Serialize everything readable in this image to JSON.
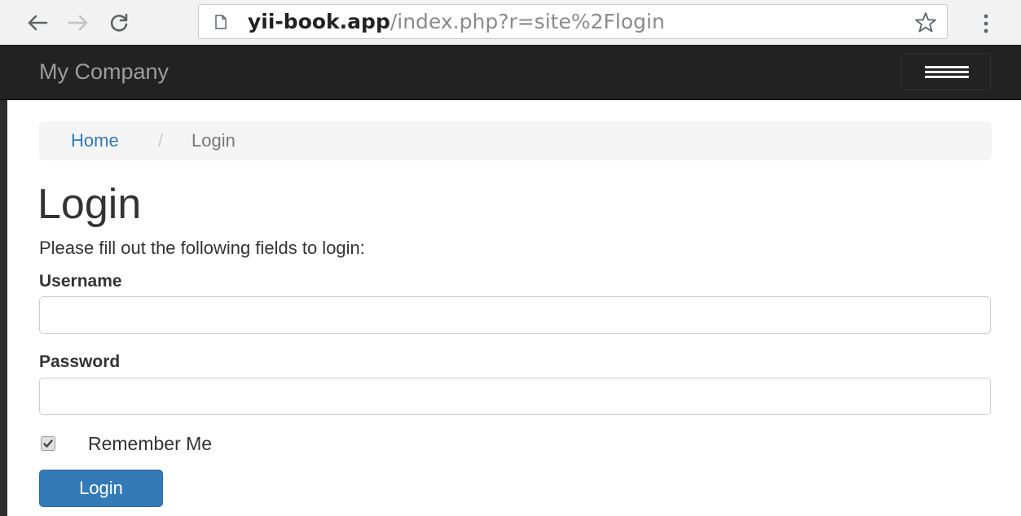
{
  "browser": {
    "url_host": "yii-book.app",
    "url_path": "/index.php?r=site%2Flogin",
    "icons": {
      "back": "arrow-left-icon",
      "forward": "arrow-right-icon",
      "reload": "reload-icon",
      "page": "page-icon",
      "bookmark": "star-icon",
      "menu": "kebab-menu-icon"
    }
  },
  "navbar": {
    "brand": "My Company",
    "toggle_icon": "hamburger-icon"
  },
  "breadcrumb": {
    "home": "Home",
    "separator": "/",
    "active": "Login"
  },
  "page": {
    "title": "Login",
    "description": "Please fill out the following fields to login:"
  },
  "form": {
    "username_label": "Username",
    "username_value": "",
    "password_label": "Password",
    "password_value": "",
    "remember_label": "Remember Me",
    "remember_checked": true,
    "submit_label": "Login"
  },
  "colors": {
    "navbar_bg": "#222222",
    "brand_text": "#9d9d9d",
    "link": "#337ab7",
    "primary_button": "#337ab7",
    "breadcrumb_bg": "#f5f5f5"
  }
}
